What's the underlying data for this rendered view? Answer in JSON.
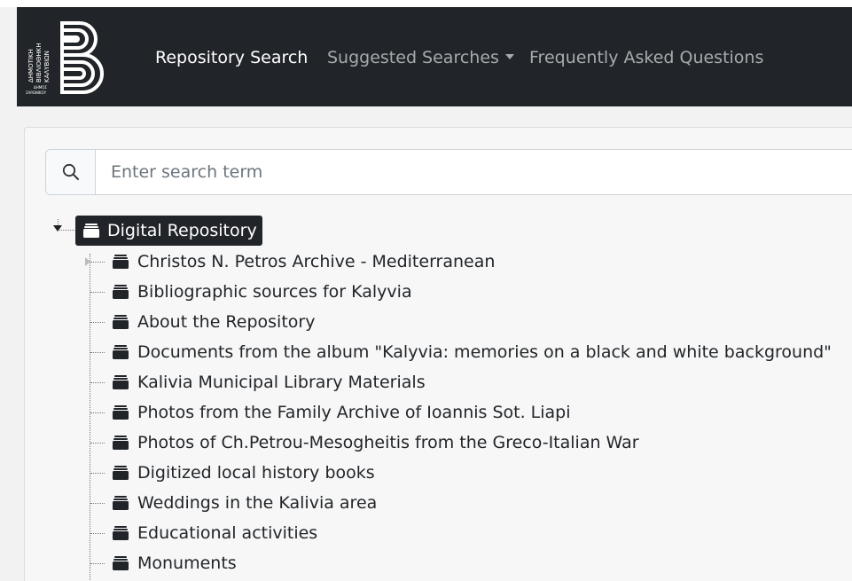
{
  "logo": {
    "text_lines": [
      "ΔΗΜΟΤΙΚΗ",
      "ΒΙΒΛΙΟΘΗΚΗ",
      "ΚΑΛΥΒΙΩΝ"
    ],
    "small_lines": [
      "ΔΗΜΟΣ",
      "ΣΑΡΩΝΙΚΟΥ"
    ],
    "icon": "library-b-logo"
  },
  "nav": {
    "repository_search": "Repository Search",
    "suggested_searches": "Suggested Searches",
    "faq": "Frequently Asked Questions"
  },
  "search": {
    "placeholder": "Enter search term",
    "value": "",
    "icon": "search-icon"
  },
  "tree": {
    "root_label": "Digital Repository",
    "items": [
      "Christos N. Petros Archive - Mediterranean",
      "Bibliographic sources for Kalyvia",
      "About the Repository",
      "Documents from the album \"Kalyvia: memories on a black and white background\"",
      "Kalivia Municipal Library Materials",
      "Photos from the Family Archive of Ioannis Sot. Liapi",
      "Photos of Ch.Petrou-Mesogheitis from the Greco-Italian War",
      "Digitized local history books",
      "Weddings in the Kalivia area",
      "Educational activities",
      "Monuments"
    ],
    "folder_icon": "folder-icon"
  },
  "colors": {
    "navbar_bg": "#212529",
    "nav_active": "#ffffff",
    "nav_muted": "#a7aaad",
    "root_bg": "#212529"
  }
}
